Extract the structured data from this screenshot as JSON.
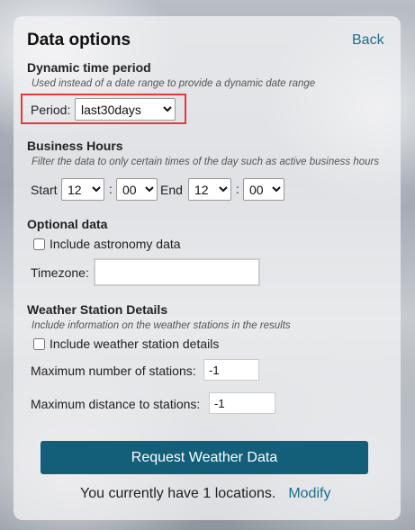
{
  "panel": {
    "title": "Data options",
    "back_label": "Back"
  },
  "dynamic_time": {
    "heading": "Dynamic time period",
    "note": "Used instead of a date range to provide a dynamic date range",
    "period_label": "Period:",
    "period_value": "last30days"
  },
  "business_hours": {
    "heading": "Business Hours",
    "note": "Filter the data to only certain times of the day such as active business hours",
    "start_label": "Start",
    "end_label": "End",
    "colon": ":",
    "start_hour": "12",
    "start_minute": "00",
    "end_hour": "12",
    "end_minute": "00"
  },
  "optional_data": {
    "heading": "Optional data",
    "astronomy_label": "Include astronomy data",
    "astronomy_checked": false,
    "timezone_label": "Timezone:",
    "timezone_value": ""
  },
  "station_details": {
    "heading": "Weather Station Details",
    "note": "Include information on the weather stations in the results",
    "include_label": "Include weather station details",
    "include_checked": false,
    "max_stations_label": "Maximum number of stations:",
    "max_stations_value": "-1",
    "max_distance_label": "Maximum distance to stations:",
    "max_distance_value": "-1"
  },
  "actions": {
    "request_label": "Request Weather Data",
    "footer_text": "You currently have 1 locations.",
    "modify_label": "Modify"
  },
  "colors": {
    "accent": "#135f7a",
    "link": "#1a6e8c",
    "highlight": "#e53a3a"
  }
}
